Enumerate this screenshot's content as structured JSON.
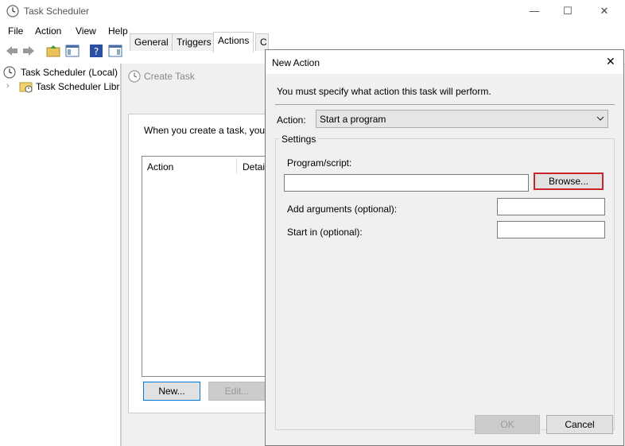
{
  "main_window": {
    "title": "Task Scheduler",
    "controls": {
      "minimize": "—",
      "maximize": "☐",
      "close": "✕"
    }
  },
  "menu": {
    "items": [
      "File",
      "Action",
      "View",
      "Help"
    ]
  },
  "tree": {
    "root_label": "Task Scheduler (Local)",
    "child_label": "Task Scheduler Libra"
  },
  "create_task": {
    "title": "Create Task",
    "tabs": [
      "General",
      "Triggers",
      "Actions",
      "C"
    ],
    "intro_text": "When you create a task, you",
    "columns": [
      "Action",
      "Detai"
    ],
    "new_button": "New...",
    "edit_button": "Edit..."
  },
  "dialog": {
    "title": "New Action",
    "close": "✕",
    "instruction": "You must specify what action this task will perform.",
    "action_label": "Action:",
    "action_value": "Start a program",
    "settings_label": "Settings",
    "program_label": "Program/script:",
    "program_value": "",
    "browse_button": "Browse...",
    "args_label": "Add arguments (optional):",
    "args_value": "",
    "startin_label": "Start in (optional):",
    "startin_value": "",
    "ok_button": "OK",
    "cancel_button": "Cancel"
  },
  "colors": {
    "highlight_border": "#c8242a",
    "primary_border": "#0078d7"
  }
}
